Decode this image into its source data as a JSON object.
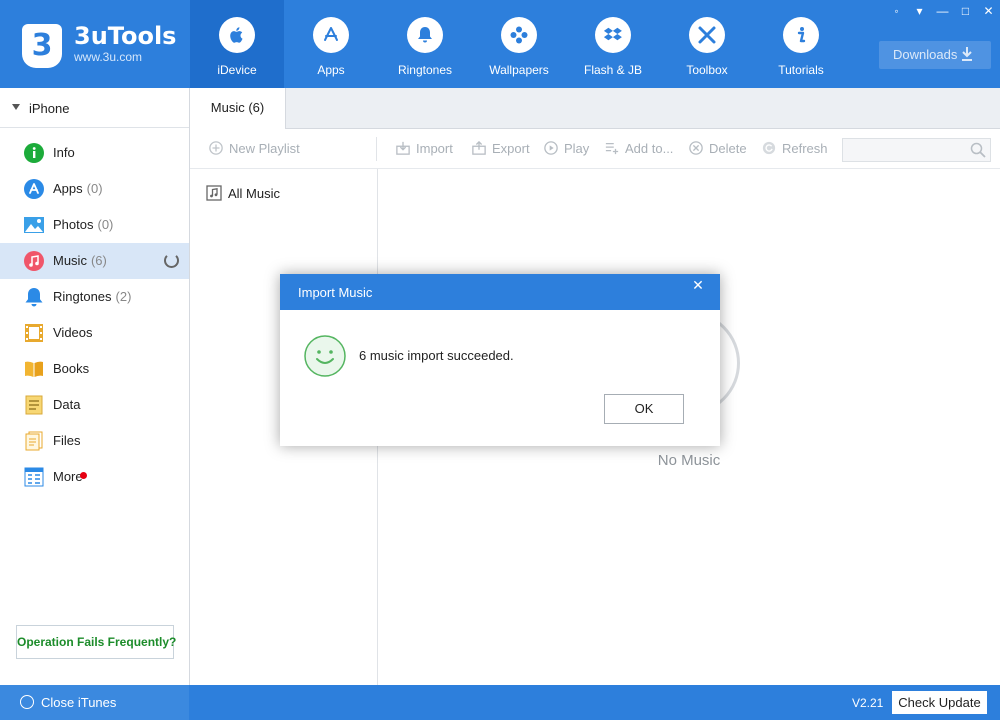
{
  "app": {
    "title": "3uTools",
    "url": "www.3u.com",
    "logo_glyph": "3",
    "brand_color": "#2d7fdc"
  },
  "nav": [
    {
      "label": "iDevice",
      "icon": "apple-icon",
      "active": true
    },
    {
      "label": "Apps",
      "icon": "app-store-icon"
    },
    {
      "label": "Ringtones",
      "icon": "bell-icon"
    },
    {
      "label": "Wallpapers",
      "icon": "flower-icon"
    },
    {
      "label": "Flash & JB",
      "icon": "dropbox-icon"
    },
    {
      "label": "Toolbox",
      "icon": "tools-icon"
    },
    {
      "label": "Tutorials",
      "icon": "info-icon"
    }
  ],
  "window_controls": [
    "shirt-icon",
    "menu-icon",
    "minimize-icon",
    "maximize-icon",
    "close-icon"
  ],
  "downloads": {
    "label": "Downloads"
  },
  "sidebar": {
    "device": "iPhone",
    "items": [
      {
        "label": "Info",
        "count": "",
        "icon": "info-circle-icon"
      },
      {
        "label": "Apps",
        "count": "(0)",
        "icon": "apps-icon"
      },
      {
        "label": "Photos",
        "count": "(0)",
        "icon": "photos-icon"
      },
      {
        "label": "Music",
        "count": "(6)",
        "icon": "music-icon",
        "active": true,
        "loading": true
      },
      {
        "label": "Ringtones",
        "count": "(2)",
        "icon": "bell-icon"
      },
      {
        "label": "Videos",
        "count": "",
        "icon": "film-icon"
      },
      {
        "label": "Books",
        "count": "",
        "icon": "book-icon"
      },
      {
        "label": "Data",
        "count": "",
        "icon": "data-icon"
      },
      {
        "label": "Files",
        "count": "",
        "icon": "files-icon"
      },
      {
        "label": "More",
        "count": "",
        "icon": "grid-icon",
        "badge": true
      }
    ],
    "help_button": "Operation Fails Frequently?"
  },
  "main": {
    "tab": "Music (6)",
    "toolbar": {
      "new_playlist": "New Playlist",
      "import": "Import",
      "export": "Export",
      "play": "Play",
      "add_to": "Add to...",
      "delete": "Delete",
      "refresh": "Refresh",
      "search_placeholder": ""
    },
    "playlist": "All Music",
    "empty_text": "No Music"
  },
  "status": {
    "close_itunes": "Close iTunes",
    "version": "V2.21",
    "check_update": "Check Update"
  },
  "dialog": {
    "title": "Import Music",
    "close": "✕",
    "message": "6 music import succeeded.",
    "ok": "OK"
  }
}
